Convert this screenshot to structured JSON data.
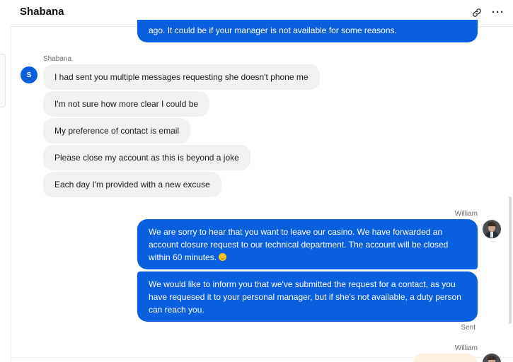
{
  "header": {
    "title": "Shabana",
    "link_icon": "link-icon",
    "more_icon": "more-horizontal-icon",
    "more_label": "···"
  },
  "top_message": {
    "text": "ago. It could be if your manager is not available for some reasons."
  },
  "customer": {
    "name": "Shabana",
    "avatar_letter": "S",
    "messages": [
      "I had sent you multiple messages requesting she doesn't phone me",
      "I'm not sure how more clear I could be",
      "My preference of contact is email",
      "Please close my account as this is beyond a joke",
      "Each day I'm provided with a new excuse"
    ]
  },
  "agent": {
    "name": "William",
    "avatar_icon": "agent-avatar",
    "messages": [
      "We are sorry to hear that you want to leave our casino. We have forwarded an account closure request to our technical department. The account will be closed within 60 minutes.",
      "We would like to inform you that we've submitted the request for a contact, as you have requesed it to your personal manager, but if she's not available, a duty person can reach you."
    ],
    "status": "Sent",
    "next_name": "William"
  },
  "colors": {
    "outgoing_bubble": "#0a5fde",
    "incoming_bubble": "#f1f1f1",
    "accent": "#0a5fde"
  }
}
